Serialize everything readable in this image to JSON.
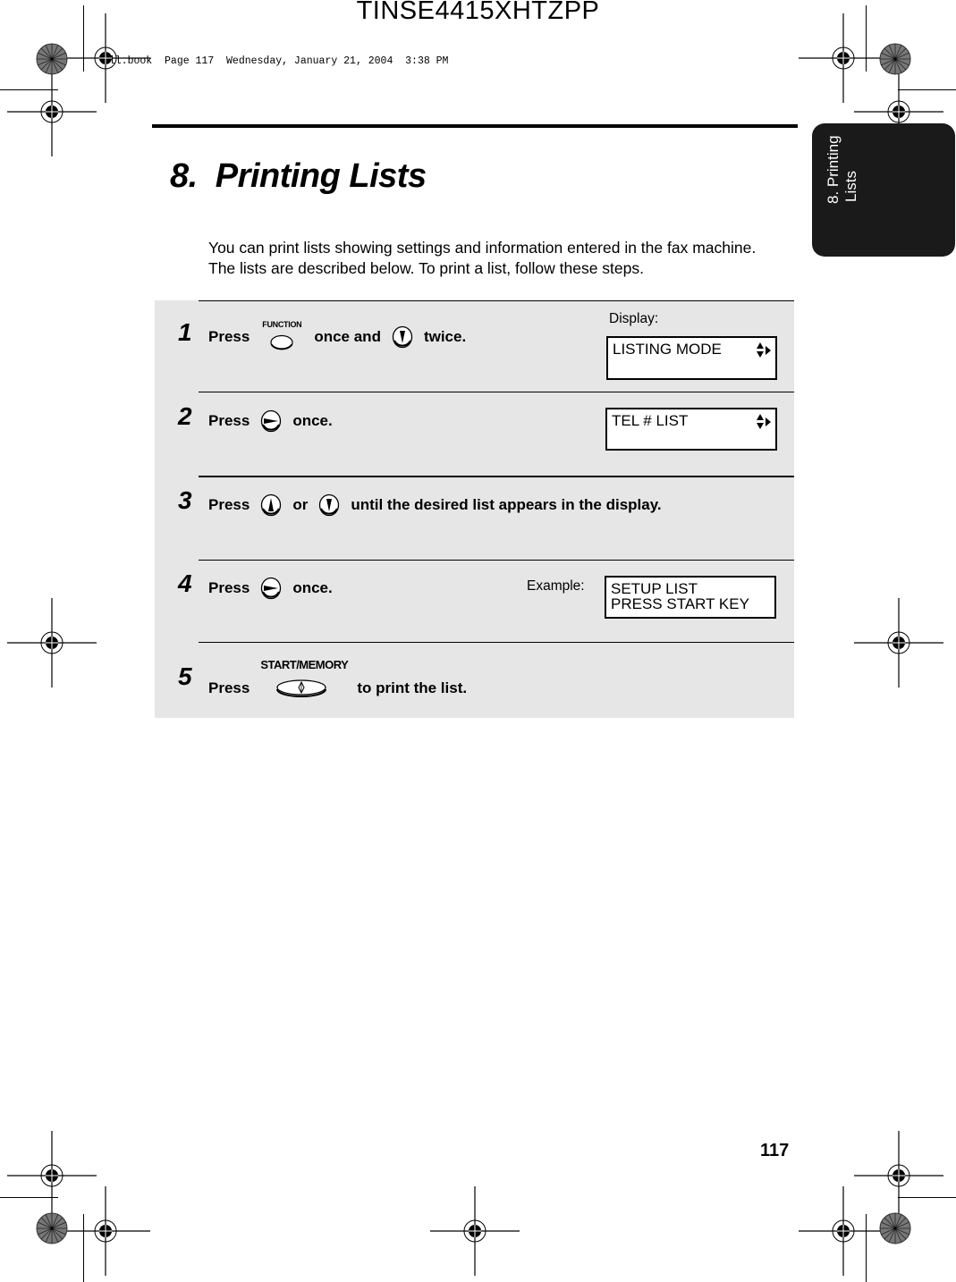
{
  "header": {
    "job_id": "TINSE4415XHTZPP",
    "book_stamp": "all.book  Page 117  Wednesday, January 21, 2004  3:38 PM"
  },
  "side_tab": {
    "line1": "8. Printing",
    "line2": "Lists"
  },
  "chapter": {
    "title": "8.  Printing Lists",
    "intro": "You can print lists showing settings and information entered in the fax machine. The lists are described below. To print a list, follow these steps."
  },
  "steps": [
    {
      "number": "1",
      "parts": {
        "press": "Press",
        "button1_label": "FUNCTION",
        "mid": "once and",
        "end": "twice."
      },
      "button1_icon": "function-key-icon",
      "button2_icon": "down-arrow-key-icon"
    },
    {
      "number": "2",
      "parts": {
        "press": "Press",
        "end": "once."
      },
      "button_icon": "right-arrow-key-icon"
    },
    {
      "number": "3",
      "parts": {
        "press": "Press",
        "mid": "or",
        "end": "until the desired list appears in the display."
      },
      "button1_icon": "up-arrow-key-icon",
      "button2_icon": "down-arrow-key-icon"
    },
    {
      "number": "4",
      "parts": {
        "press": "Press",
        "end": "once."
      },
      "button_icon": "right-arrow-key-icon"
    },
    {
      "number": "5",
      "parts": {
        "press": "Press",
        "button_label": "START/MEMORY",
        "end": "to print the list."
      },
      "button_icon": "start-memory-key-icon"
    }
  ],
  "displays": {
    "display_label": "Display:",
    "example_label": "Example:",
    "lcd1": {
      "line1": "LISTING MODE",
      "line2": ""
    },
    "lcd2": {
      "line1": "TEL # LIST",
      "line2": ""
    },
    "lcd3": {
      "line1": "SETUP LIST",
      "line2": "PRESS START KEY"
    }
  },
  "footer": {
    "page_number": "117"
  }
}
